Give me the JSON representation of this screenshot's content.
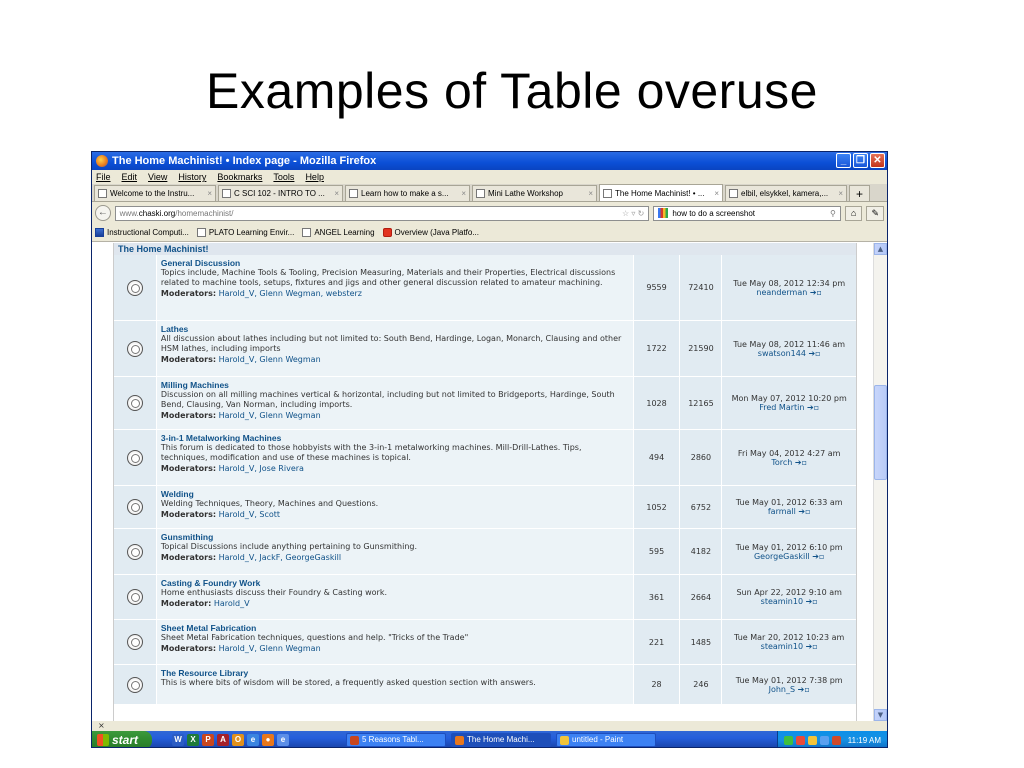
{
  "slide": {
    "title": "Examples of Table overuse"
  },
  "window": {
    "title": "The Home Machinist! • Index page - Mozilla Firefox",
    "menu": [
      "File",
      "Edit",
      "View",
      "History",
      "Bookmarks",
      "Tools",
      "Help"
    ],
    "tabs": [
      {
        "label": "Welcome to the Instru...",
        "active": false
      },
      {
        "label": "C SCI 102 - INTRO TO ...",
        "active": false
      },
      {
        "label": "Learn how to make a s...",
        "active": false
      },
      {
        "label": "Mini Lathe Workshop",
        "active": false
      },
      {
        "label": "The Home Machinist! • ...",
        "active": true
      },
      {
        "label": "elbil, elsykkel, kamera,...",
        "active": false
      }
    ],
    "url": {
      "prefix": "www.",
      "domain": "chaski.org",
      "path": "/homemachinist/"
    },
    "search": "how to do a screenshot",
    "bookmarks": [
      "Instructional Computi...",
      "PLATO Learning Envir...",
      "ANGEL Learning",
      "Overview (Java Platfo..."
    ],
    "status_close": "×"
  },
  "forum": {
    "category": "The Home Machinist!",
    "rows": [
      {
        "title": "General Discussion",
        "desc": "Topics include, Machine Tools & Tooling, Precision Measuring, Materials and their Properties, Electrical discussions related to machine tools, setups, fixtures and jigs and other general discussion related to amateur machining.",
        "mods_label": "Moderators:",
        "mods": "Harold_V, Glenn Wegman, websterz",
        "topics": "9559",
        "posts": "72410",
        "last_date": "Tue May 08, 2012 12:34 pm",
        "last_user": "neanderman"
      },
      {
        "title": "Lathes",
        "desc": "All discussion about lathes including but not limited to: South Bend, Hardinge, Logan, Monarch, Clausing and other HSM lathes, including imports",
        "mods_label": "Moderators:",
        "mods": "Harold_V, Glenn Wegman",
        "topics": "1722",
        "posts": "21590",
        "last_date": "Tue May 08, 2012 11:46 am",
        "last_user": "swatson144"
      },
      {
        "title": "Milling Machines",
        "desc": "Discussion on all milling machines vertical & horizontal, including but not limited to Bridgeports, Hardinge, South Bend, Clausing, Van Norman, including imports.",
        "mods_label": "Moderators:",
        "mods": "Harold_V, Glenn Wegman",
        "topics": "1028",
        "posts": "12165",
        "last_date": "Mon May 07, 2012 10:20 pm",
        "last_user": "Fred Martin"
      },
      {
        "title": "3-in-1 Metalworking Machines",
        "desc": "This forum is dedicated to those hobbyists with the 3-in-1 metalworking machines. Mill-Drill-Lathes. Tips, techniques, modification and use of these machines is topical.",
        "mods_label": "Moderators:",
        "mods": "Harold_V, Jose Rivera",
        "topics": "494",
        "posts": "2860",
        "last_date": "Fri May 04, 2012 4:27 am",
        "last_user": "Torch"
      },
      {
        "title": "Welding",
        "desc": "Welding Techniques, Theory, Machines and Questions.",
        "mods_label": "Moderators:",
        "mods": "Harold_V, Scott",
        "topics": "1052",
        "posts": "6752",
        "last_date": "Tue May 01, 2012 6:33 am",
        "last_user": "farmall"
      },
      {
        "title": "Gunsmithing",
        "desc": "Topical Discussions include anything pertaining to Gunsmithing.",
        "mods_label": "Moderators:",
        "mods": "Harold_V, JackF, GeorgeGaskill",
        "topics": "595",
        "posts": "4182",
        "last_date": "Tue May 01, 2012 6:10 pm",
        "last_user": "GeorgeGaskill"
      },
      {
        "title": "Casting & Foundry Work",
        "desc": "Home enthusiasts discuss their Foundry & Casting work.",
        "mods_label": "Moderator:",
        "mods": "Harold_V",
        "topics": "361",
        "posts": "2664",
        "last_date": "Sun Apr 22, 2012 9:10 am",
        "last_user": "steamin10"
      },
      {
        "title": "Sheet Metal Fabrication",
        "desc": "Sheet Metal Fabrication techniques, questions and help. \"Tricks of the Trade\"",
        "mods_label": "Moderators:",
        "mods": "Harold_V, Glenn Wegman",
        "topics": "221",
        "posts": "1485",
        "last_date": "Tue Mar 20, 2012 10:23 am",
        "last_user": "steamin10"
      },
      {
        "title": "The Resource Library",
        "desc": "This is where bits of wisdom will be stored, a frequently asked question section with answers.",
        "mods_label": "",
        "mods": "",
        "topics": "28",
        "posts": "246",
        "last_date": "Tue May 01, 2012 7:38 pm",
        "last_user": "John_S"
      }
    ]
  },
  "taskbar": {
    "start": "start",
    "buttons": [
      "5 Reasons Tabl...",
      "The Home Machi...",
      "untitled - Paint"
    ],
    "clock": "11:19 AM"
  }
}
